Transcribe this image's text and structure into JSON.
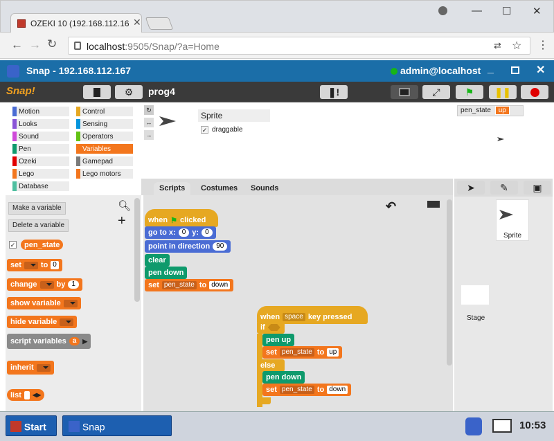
{
  "browser": {
    "tab_title": "OZEKI 10 (192.168.112.16",
    "url_host": "localhost",
    "url_rest": ":9505/Snap/?a=Home",
    "window_buttons": [
      "—",
      "☐",
      "✕"
    ]
  },
  "app": {
    "title": "Snap - 192.168.112.167",
    "user": "admin@localhost",
    "project_name": "prog4",
    "logo_text": "Snap!"
  },
  "categories": [
    {
      "label": "Motion",
      "color": "#4a6cd4"
    },
    {
      "label": "Control",
      "color": "#e6a822"
    },
    {
      "label": "Looks",
      "color": "#8a55d7"
    },
    {
      "label": "Sensing",
      "color": "#0494dc"
    },
    {
      "label": "Sound",
      "color": "#cf4ad9"
    },
    {
      "label": "Operators",
      "color": "#62c213"
    },
    {
      "label": "Pen",
      "color": "#0e9a6c"
    },
    {
      "label": "Variables",
      "color": "#f3761d"
    },
    {
      "label": "Ozeki",
      "color": "#e20000"
    },
    {
      "label": "Gamepad",
      "color": "#7a7a7a"
    },
    {
      "label": "Lego",
      "color": "#f3761d"
    },
    {
      "label": "Lego motors",
      "color": "#f3761d"
    },
    {
      "label": "Database",
      "color": "#4fbfa0"
    }
  ],
  "palette": {
    "make_variable": "Make a variable",
    "delete_variable": "Delete a variable",
    "var_name": "pen_state",
    "set_label": "set",
    "to_label": "to",
    "set_value": "0",
    "change_label": "change",
    "by_label": "by",
    "change_value": "1",
    "show_variable": "show variable",
    "hide_variable": "hide variable",
    "script_variables": "script variables",
    "script_var_name": "a",
    "inherit": "inherit",
    "list": "list"
  },
  "sprite": {
    "name": "Sprite",
    "draggable": "draggable"
  },
  "editor_tabs": [
    "Scripts",
    "Costumes",
    "Sounds"
  ],
  "script1": {
    "when": "when",
    "clicked": "clicked",
    "goto": "go to x:",
    "x": "0",
    "y_label": "y:",
    "y": "0",
    "point_dir": "point in direction",
    "dir": "90",
    "clear": "clear",
    "pen_down": "pen down",
    "set": "set",
    "var": "pen_state",
    "to": "to",
    "value": "down"
  },
  "script2": {
    "when": "when",
    "key": "space",
    "key_pressed": "key pressed",
    "if": "if",
    "pen_up": "pen up",
    "set": "set",
    "var": "pen_state",
    "to": "to",
    "value_up": "up",
    "else": "else",
    "pen_down": "pen down",
    "value_down": "down"
  },
  "stage": {
    "watcher_label": "pen_state",
    "watcher_value": "up"
  },
  "corral": {
    "sprite_label": "Sprite",
    "stage_label": "Stage"
  },
  "taskbar": {
    "start": "Start",
    "app": "Snap",
    "time": "10:53"
  }
}
